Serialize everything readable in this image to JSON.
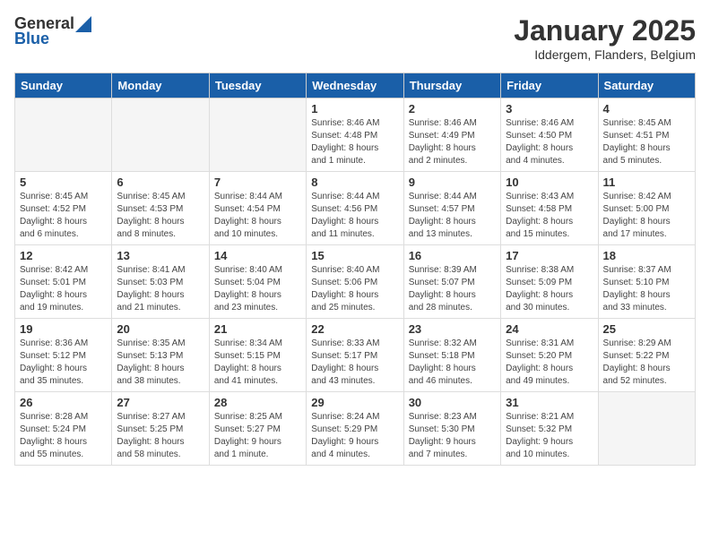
{
  "header": {
    "logo_general": "General",
    "logo_blue": "Blue",
    "month_title": "January 2025",
    "location": "Iddergem, Flanders, Belgium"
  },
  "weekdays": [
    "Sunday",
    "Monday",
    "Tuesday",
    "Wednesday",
    "Thursday",
    "Friday",
    "Saturday"
  ],
  "weeks": [
    [
      {
        "day": "",
        "detail": ""
      },
      {
        "day": "",
        "detail": ""
      },
      {
        "day": "",
        "detail": ""
      },
      {
        "day": "1",
        "detail": "Sunrise: 8:46 AM\nSunset: 4:48 PM\nDaylight: 8 hours\nand 1 minute."
      },
      {
        "day": "2",
        "detail": "Sunrise: 8:46 AM\nSunset: 4:49 PM\nDaylight: 8 hours\nand 2 minutes."
      },
      {
        "day": "3",
        "detail": "Sunrise: 8:46 AM\nSunset: 4:50 PM\nDaylight: 8 hours\nand 4 minutes."
      },
      {
        "day": "4",
        "detail": "Sunrise: 8:45 AM\nSunset: 4:51 PM\nDaylight: 8 hours\nand 5 minutes."
      }
    ],
    [
      {
        "day": "5",
        "detail": "Sunrise: 8:45 AM\nSunset: 4:52 PM\nDaylight: 8 hours\nand 6 minutes."
      },
      {
        "day": "6",
        "detail": "Sunrise: 8:45 AM\nSunset: 4:53 PM\nDaylight: 8 hours\nand 8 minutes."
      },
      {
        "day": "7",
        "detail": "Sunrise: 8:44 AM\nSunset: 4:54 PM\nDaylight: 8 hours\nand 10 minutes."
      },
      {
        "day": "8",
        "detail": "Sunrise: 8:44 AM\nSunset: 4:56 PM\nDaylight: 8 hours\nand 11 minutes."
      },
      {
        "day": "9",
        "detail": "Sunrise: 8:44 AM\nSunset: 4:57 PM\nDaylight: 8 hours\nand 13 minutes."
      },
      {
        "day": "10",
        "detail": "Sunrise: 8:43 AM\nSunset: 4:58 PM\nDaylight: 8 hours\nand 15 minutes."
      },
      {
        "day": "11",
        "detail": "Sunrise: 8:42 AM\nSunset: 5:00 PM\nDaylight: 8 hours\nand 17 minutes."
      }
    ],
    [
      {
        "day": "12",
        "detail": "Sunrise: 8:42 AM\nSunset: 5:01 PM\nDaylight: 8 hours\nand 19 minutes."
      },
      {
        "day": "13",
        "detail": "Sunrise: 8:41 AM\nSunset: 5:03 PM\nDaylight: 8 hours\nand 21 minutes."
      },
      {
        "day": "14",
        "detail": "Sunrise: 8:40 AM\nSunset: 5:04 PM\nDaylight: 8 hours\nand 23 minutes."
      },
      {
        "day": "15",
        "detail": "Sunrise: 8:40 AM\nSunset: 5:06 PM\nDaylight: 8 hours\nand 25 minutes."
      },
      {
        "day": "16",
        "detail": "Sunrise: 8:39 AM\nSunset: 5:07 PM\nDaylight: 8 hours\nand 28 minutes."
      },
      {
        "day": "17",
        "detail": "Sunrise: 8:38 AM\nSunset: 5:09 PM\nDaylight: 8 hours\nand 30 minutes."
      },
      {
        "day": "18",
        "detail": "Sunrise: 8:37 AM\nSunset: 5:10 PM\nDaylight: 8 hours\nand 33 minutes."
      }
    ],
    [
      {
        "day": "19",
        "detail": "Sunrise: 8:36 AM\nSunset: 5:12 PM\nDaylight: 8 hours\nand 35 minutes."
      },
      {
        "day": "20",
        "detail": "Sunrise: 8:35 AM\nSunset: 5:13 PM\nDaylight: 8 hours\nand 38 minutes."
      },
      {
        "day": "21",
        "detail": "Sunrise: 8:34 AM\nSunset: 5:15 PM\nDaylight: 8 hours\nand 41 minutes."
      },
      {
        "day": "22",
        "detail": "Sunrise: 8:33 AM\nSunset: 5:17 PM\nDaylight: 8 hours\nand 43 minutes."
      },
      {
        "day": "23",
        "detail": "Sunrise: 8:32 AM\nSunset: 5:18 PM\nDaylight: 8 hours\nand 46 minutes."
      },
      {
        "day": "24",
        "detail": "Sunrise: 8:31 AM\nSunset: 5:20 PM\nDaylight: 8 hours\nand 49 minutes."
      },
      {
        "day": "25",
        "detail": "Sunrise: 8:29 AM\nSunset: 5:22 PM\nDaylight: 8 hours\nand 52 minutes."
      }
    ],
    [
      {
        "day": "26",
        "detail": "Sunrise: 8:28 AM\nSunset: 5:24 PM\nDaylight: 8 hours\nand 55 minutes."
      },
      {
        "day": "27",
        "detail": "Sunrise: 8:27 AM\nSunset: 5:25 PM\nDaylight: 8 hours\nand 58 minutes."
      },
      {
        "day": "28",
        "detail": "Sunrise: 8:25 AM\nSunset: 5:27 PM\nDaylight: 9 hours\nand 1 minute."
      },
      {
        "day": "29",
        "detail": "Sunrise: 8:24 AM\nSunset: 5:29 PM\nDaylight: 9 hours\nand 4 minutes."
      },
      {
        "day": "30",
        "detail": "Sunrise: 8:23 AM\nSunset: 5:30 PM\nDaylight: 9 hours\nand 7 minutes."
      },
      {
        "day": "31",
        "detail": "Sunrise: 8:21 AM\nSunset: 5:32 PM\nDaylight: 9 hours\nand 10 minutes."
      },
      {
        "day": "",
        "detail": ""
      }
    ]
  ]
}
